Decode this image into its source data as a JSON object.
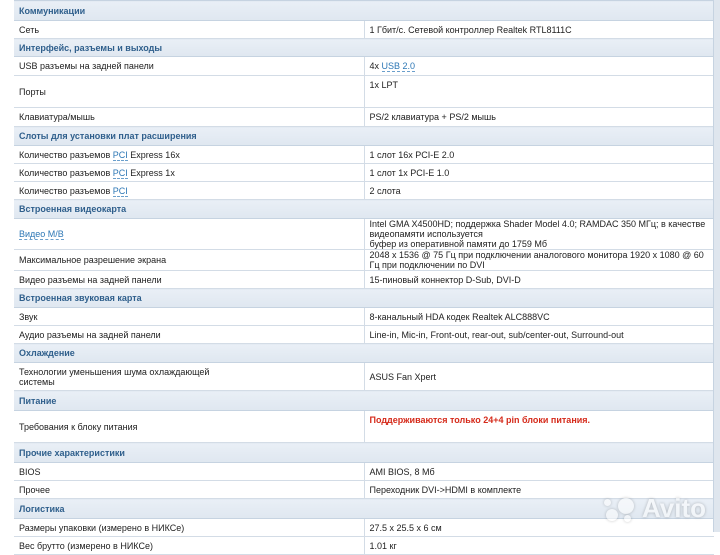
{
  "sections": [
    {
      "title": "Коммуникации"
    },
    {
      "title": "Интерфейс, разъемы и выходы"
    },
    {
      "title": "Слоты для установки плат расширения"
    },
    {
      "title": "Встроенная видеокарта"
    },
    {
      "title": "Встроенная звуковая карта"
    },
    {
      "title": "Охлаждение"
    },
    {
      "title": "Питание"
    },
    {
      "title": "Прочие характеристики"
    },
    {
      "title": "Логистика"
    }
  ],
  "rows": {
    "network": {
      "label": "Сеть",
      "value": "1 Гбит/с. Сетевой контроллер Realtek RTL8111C"
    },
    "usb": {
      "label": "USB разъемы на задней панели",
      "value_prefix": "4x ",
      "value_link": "USB 2.0"
    },
    "ports": {
      "label": "Порты",
      "value": "1x LPT"
    },
    "kbd": {
      "label": "Клавиатура/мышь",
      "value": "PS/2 клавиатура + PS/2 мышь"
    },
    "pcie16": {
      "label_prefix": "Количество разъемов ",
      "label_link": "PCI",
      "label_suffix": " Express 16x",
      "value": "1 слот 16x PCI-E 2.0"
    },
    "pcie1": {
      "label_prefix": "Количество разъемов ",
      "label_link": "PCI",
      "label_suffix": " Express 1x",
      "value": "1 слот 1x PCI-E 1.0"
    },
    "pci": {
      "label_prefix": "Количество разъемов ",
      "label_link": "PCI",
      "value": "2 слота"
    },
    "video": {
      "label_link": "Видео M/B",
      "value_line1": "Intel GMA X4500HD; поддержка Shader Model 4.0; RAMDAC 350 МГц; в качестве видеопамяти используется",
      "value_line2": "буфер из оперативной памяти до 1759 Мб"
    },
    "maxres": {
      "label": "Максимальное разрешение экрана",
      "value": "2048 x 1536 @ 75 Гц при подключении аналогового монитора 1920 x 1080 @ 60 Гц при подключении по DVI"
    },
    "vout": {
      "label": "Видео разъемы на задней панели",
      "value": "15-пиновый коннектор D-Sub, DVI-D"
    },
    "sound": {
      "label": "Звук",
      "value": "8-канальный HDA кодек Realtek ALC888VC"
    },
    "audio": {
      "label": "Аудио разъемы на задней панели",
      "value": "Line-in, Mic-in, Front-out, rear-out, sub/center-out, Surround-out"
    },
    "noise": {
      "label_line1": "Технологии уменьшения шума охлаждающей",
      "label_line2": "системы",
      "value": "ASUS Fan Xpert"
    },
    "psu": {
      "label": "Требования к блоку питания",
      "value": "Поддерживаются только 24+4 pin блоки питания."
    },
    "bios": {
      "label": "BIOS",
      "value": "AMI BIOS, 8 Мб"
    },
    "other": {
      "label": "Прочее",
      "value": "Переходник DVI->HDMI в комплекте"
    },
    "pack": {
      "label": "Размеры упаковки (измерено в НИКСе)",
      "value": "27.5 x 25.5 x 6 см"
    },
    "weight": {
      "label": "Вес брутто (измерено в НИКСе)",
      "value": "1.01 кг"
    }
  },
  "watermark": {
    "text": "Avito"
  },
  "colors": {
    "section_text": "#2f5f8c",
    "link": "#2d77b5",
    "warning": "#d52a1a"
  }
}
